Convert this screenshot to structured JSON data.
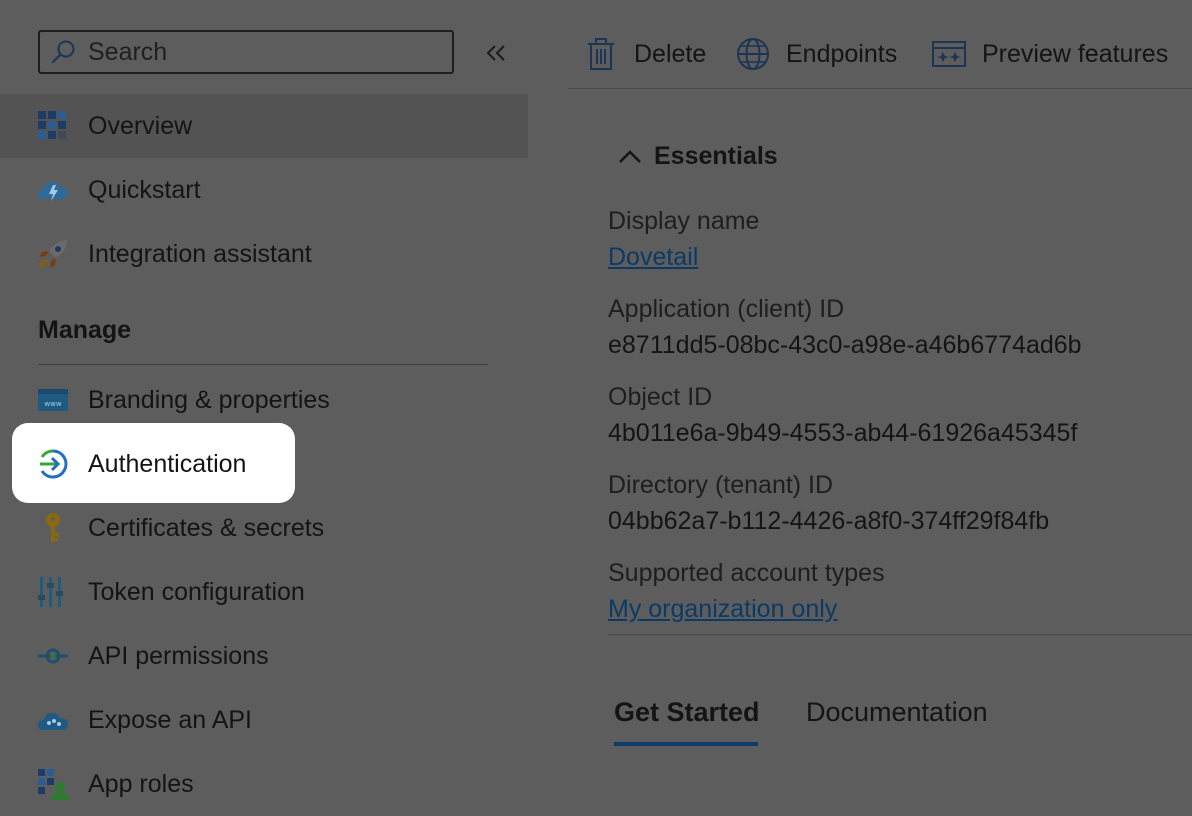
{
  "sidebar": {
    "search_placeholder": "Search",
    "collapse_icon": "double-chevron-left-icon",
    "items": [
      {
        "label": "Overview",
        "icon": "overview-grid-icon",
        "selected": true
      },
      {
        "label": "Quickstart",
        "icon": "quickstart-cloud-icon"
      },
      {
        "label": "Integration assistant",
        "icon": "rocket-icon"
      }
    ],
    "manage_title": "Manage",
    "manage_items": [
      {
        "label": "Branding & properties",
        "icon": "branding-www-icon"
      },
      {
        "label": "Authentication",
        "icon": "authentication-arrow-icon",
        "highlighted": true
      },
      {
        "label": "Certificates & secrets",
        "icon": "key-icon"
      },
      {
        "label": "Token configuration",
        "icon": "token-bars-icon"
      },
      {
        "label": "API permissions",
        "icon": "api-permissions-icon"
      },
      {
        "label": "Expose an API",
        "icon": "expose-api-cloud-icon"
      },
      {
        "label": "App roles",
        "icon": "app-roles-icon"
      }
    ]
  },
  "toolbar": {
    "delete_label": "Delete",
    "endpoints_label": "Endpoints",
    "preview_label": "Preview features"
  },
  "essentials": {
    "title": "Essentials",
    "display_name_label": "Display name",
    "display_name_value": "Dovetail",
    "app_id_label": "Application (client) ID",
    "app_id_value": "e8711dd5-08bc-43c0-a98e-a46b6774ad6b",
    "object_id_label": "Object ID",
    "object_id_value": "4b011e6a-9b49-4553-ab44-61926a45345f",
    "tenant_id_label": "Directory (tenant) ID",
    "tenant_id_value": "04bb62a7-b112-4426-a8f0-374ff29f84fb",
    "account_types_label": "Supported account types",
    "account_types_value": "My organization only"
  },
  "tabs": {
    "get_started": "Get Started",
    "documentation": "Documentation"
  },
  "colors": {
    "overlay_bg": "#5d5d5d",
    "selected_bg": "#535353",
    "link": "#0b3a66",
    "tab_underline": "#0d3c68"
  }
}
